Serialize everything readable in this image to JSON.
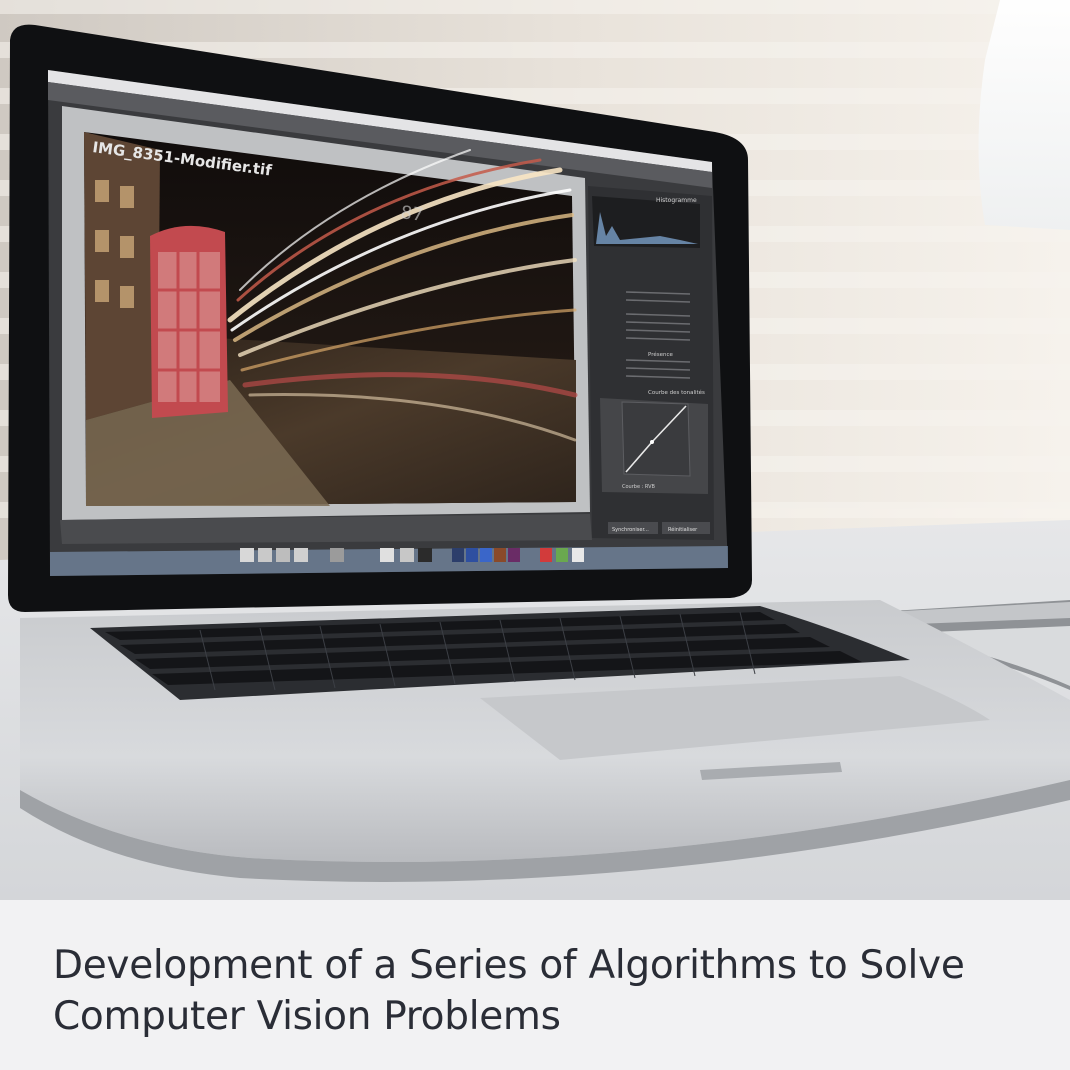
{
  "caption": {
    "title": "Development of a Series of Algorithms to Solve Computer Vision Problems"
  },
  "photo": {
    "subject": "laptop-on-desk",
    "screen_app": {
      "filename": "IMG_8351-Modifier.tif",
      "panel_histogram": "Histogramme",
      "panel_tone_curve": "Courbe des tonalités",
      "panel_presence": "Présence",
      "sync_button": "Synchroniser...",
      "reset_button": "Réinitialiser",
      "curve_channel": "Courbe : RVB",
      "overlay_number": "87"
    },
    "colors": {
      "caption_bg": "#f2f2f3",
      "caption_text": "#2a2d36",
      "phone_box_red": "#c24a4f"
    }
  }
}
